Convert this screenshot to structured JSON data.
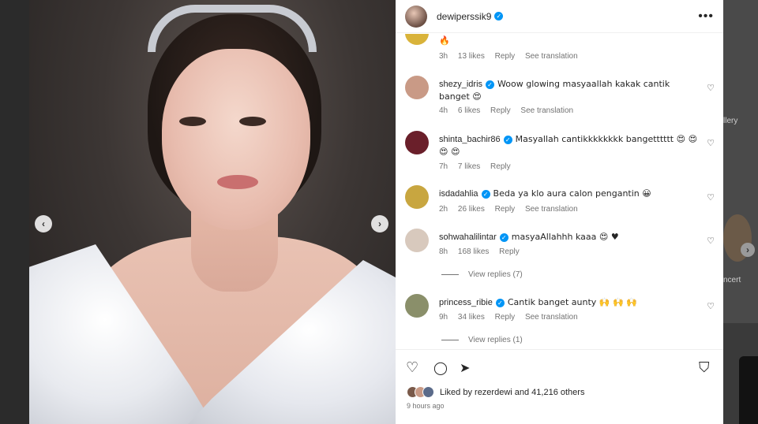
{
  "backdrop": {
    "side_texts": [
      "llery",
      "ncert"
    ],
    "next_symbol": "›"
  },
  "photo": {
    "prev_symbol": "‹",
    "next_symbol": "›"
  },
  "post": {
    "username": "dewiperssik9",
    "verified_symbol": "✓",
    "more_symbol": "•••"
  },
  "comments": [
    {
      "username": "",
      "text": "🔥",
      "time": "3h",
      "likes": "13 likes",
      "reply": "Reply",
      "translation": "See translation",
      "verified": false,
      "avatar_color": "#d9b33a"
    },
    {
      "username": "shezy_idris",
      "text": "Woow glowing masyaallah kakak cantik banget 😍",
      "time": "4h",
      "likes": "6 likes",
      "reply": "Reply",
      "translation": "See translation",
      "verified": true,
      "avatar_color": "#c99a86"
    },
    {
      "username": "shinta_bachir86",
      "text": "Masyallah cantikkkkkkkk bangetttttt 😍 😍 😍 😍",
      "time": "7h",
      "likes": "7 likes",
      "reply": "Reply",
      "translation": "",
      "verified": true,
      "avatar_color": "#6a1f2a"
    },
    {
      "username": "isdadahlia",
      "text": "Beda ya klo aura calon pengantin 😀",
      "time": "2h",
      "likes": "26 likes",
      "reply": "Reply",
      "translation": "See translation",
      "verified": true,
      "avatar_color": "#c8a640"
    },
    {
      "username": "sohwahalilintar",
      "text": "masyaAllahhh kaaa 😍 ♥",
      "time": "8h",
      "likes": "168 likes",
      "reply": "Reply",
      "translation": "",
      "verified": true,
      "avatar_color": "#d8c9bd"
    },
    {
      "username": "princess_ribie",
      "text": "Cantik banget aunty 🙌 🙌 🙌",
      "time": "9h",
      "likes": "34 likes",
      "reply": "Reply",
      "translation": "See translation",
      "verified": true,
      "avatar_color": "#8a8f6a"
    }
  ],
  "view_replies": [
    "View replies (7)",
    "View replies (1)"
  ],
  "actions": {
    "like_icon": "♡",
    "comment_icon": "◯",
    "share_icon": "➤",
    "save_icon": "⛉"
  },
  "likes_summary": "Liked by rezerdewi and 41,216 others",
  "posted_time": "9 hours ago",
  "colors": {
    "verified": "#0095f6",
    "text": "#262626",
    "muted": "#737373"
  }
}
